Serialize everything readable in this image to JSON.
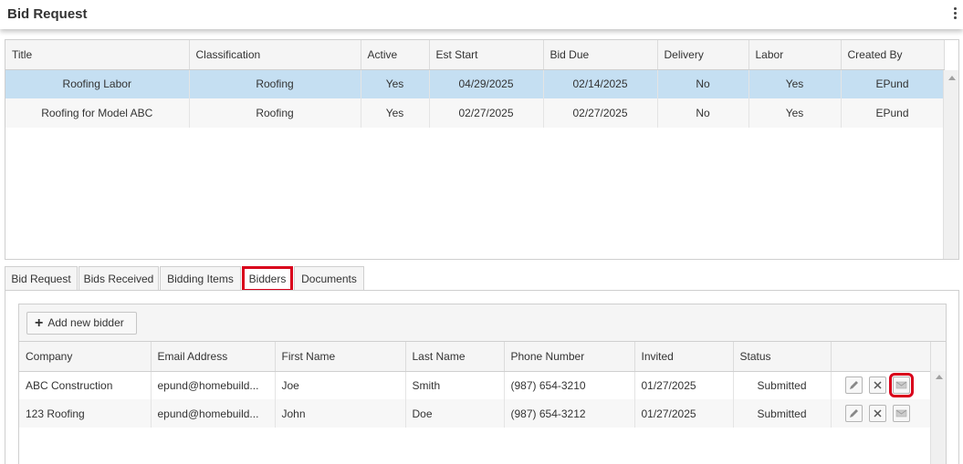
{
  "header": {
    "title": "Bid Request"
  },
  "requests": {
    "columns": [
      "Title",
      "Classification",
      "Active",
      "Est Start",
      "Bid Due",
      "Delivery",
      "Labor",
      "Created By"
    ],
    "rows": [
      [
        "Roofing Labor",
        "Roofing",
        "Yes",
        "04/29/2025",
        "02/14/2025",
        "No",
        "Yes",
        "EPund"
      ],
      [
        "Roofing for Model ABC",
        "Roofing",
        "Yes",
        "02/27/2025",
        "02/27/2025",
        "No",
        "Yes",
        "EPund"
      ]
    ]
  },
  "tabs": [
    "Bid Request",
    "Bids Received",
    "Bidding Items",
    "Bidders",
    "Documents"
  ],
  "active_tab": "Bidders",
  "bidders": {
    "add_label": "Add new bidder",
    "columns": [
      "Company",
      "Email Address",
      "First Name",
      "Last Name",
      "Phone Number",
      "Invited",
      "Status"
    ],
    "rows": [
      [
        "ABC Construction",
        "epund@homebuild...",
        "Joe",
        "Smith",
        "(987) 654-3210",
        "01/27/2025",
        "Submitted"
      ],
      [
        "123 Roofing",
        "epund@homebuild...",
        "John",
        "Doe",
        "(987) 654-3212",
        "01/27/2025",
        "Submitted"
      ]
    ],
    "row_actions": [
      "pencil-icon",
      "x-icon",
      "envelope-icon"
    ]
  },
  "colors": {
    "selected_row": "#c5dff2",
    "highlight": "#d9001b"
  }
}
